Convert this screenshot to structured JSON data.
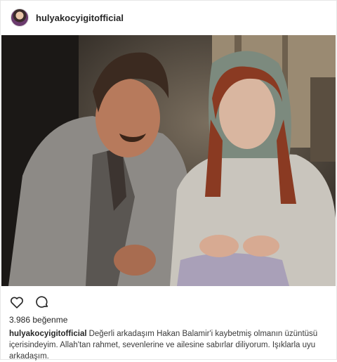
{
  "post": {
    "username": "hulyakocyigitofficial",
    "likes_text": "3.986 beğenme",
    "caption_user": "hulyakocyigitofficial",
    "caption_text": "Değerli arkadaşım Hakan Balamir'i kaybetmiş olmanın üzüntüsü içerisindeyim. Allah'tan rahmet, sevenlerine ve ailesine sabırlar diliyorum. Işıklarla uyu arkadaşım."
  },
  "icons": {
    "like": "heart-outline-icon",
    "comment": "speech-bubble-icon"
  },
  "colors": {
    "text": "#262626",
    "border": "#e6e6e6"
  }
}
